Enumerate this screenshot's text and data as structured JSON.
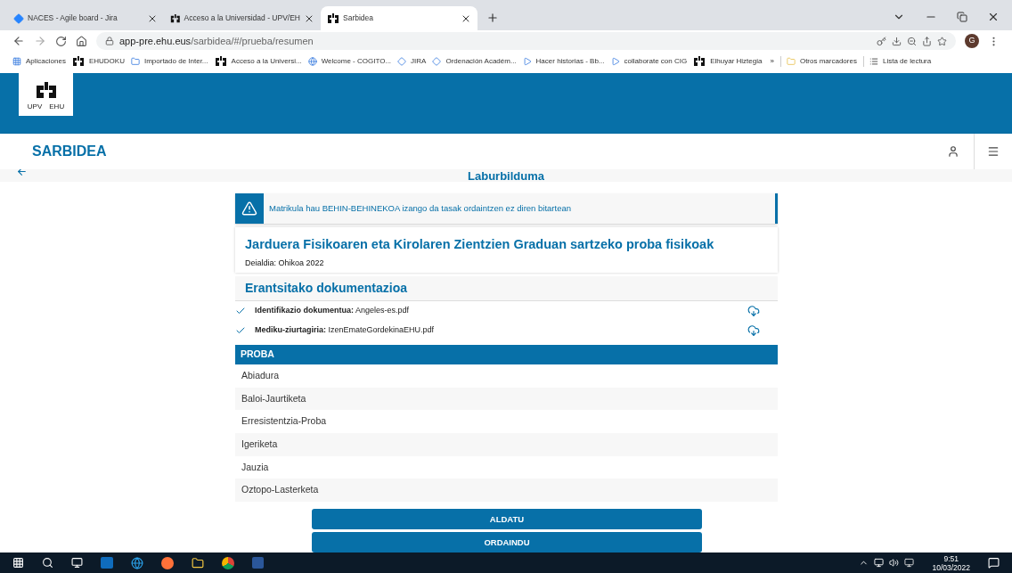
{
  "browser": {
    "tabs": [
      {
        "title": "NACES - Agile board - Jira",
        "selected": false
      },
      {
        "title": "Acceso a la Universidad - UPV/EH",
        "selected": false
      },
      {
        "title": "Sarbidea",
        "selected": true
      }
    ],
    "url_host": "app-pre.ehu.eus",
    "url_path": "/sarbidea/#/prueba/resumen",
    "profile_initial": "G",
    "bookmarks": [
      {
        "label": "Aplicaciones"
      },
      {
        "label": "EHUDOKU"
      },
      {
        "label": "Importado de Inter..."
      },
      {
        "label": "Acceso a la Universi..."
      },
      {
        "label": "Welcome - COGITO..."
      },
      {
        "label": "JIRA"
      },
      {
        "label": "Ordenación Académ..."
      },
      {
        "label": "Hacer historias - Bb..."
      },
      {
        "label": "collaborate con CIG"
      },
      {
        "label": "Elhuyar Hiztegia"
      }
    ],
    "more": "»",
    "other_bookmarks": "Otros marcadores",
    "reading_list": "Lista de lectura"
  },
  "header": {
    "logo_left": "UPV",
    "logo_right": "EHU"
  },
  "app_bar": {
    "title": "SARBIDEA"
  },
  "page": {
    "title": "Laburbilduma",
    "alert": "Matrikula hau BEHIN-BEHINEKOA izango da tasak ordaintzen ez diren bitartean",
    "card": {
      "title": "Jarduera Fisikoaren eta Kirolaren Zientzien Graduan sartzeko proba fisikoak",
      "subtitle": "Deialdia: Ohikoa 2022"
    },
    "documents": {
      "heading": "Erantsitako dokumentazioa",
      "items": [
        {
          "label": "Identifikazio dokumentua:",
          "file": "Angeles-es.pdf",
          "checked": true
        },
        {
          "label": "Mediku-ziurtagiria:",
          "file": "IzenEmateGordekinaEHU.pdf",
          "checked": true
        }
      ]
    },
    "tests": {
      "heading": "PROBA",
      "rows": [
        "Abiadura",
        "Baloi-Jaurtiketa",
        "Erresistentzia-Proba",
        "Igeriketa",
        "Jauzia",
        "Oztopo-Lasterketa"
      ]
    },
    "buttons": [
      "ALDATU",
      "ORDAINDU"
    ]
  },
  "taskbar": {
    "time": "9:51",
    "date": "10/03/2022"
  }
}
